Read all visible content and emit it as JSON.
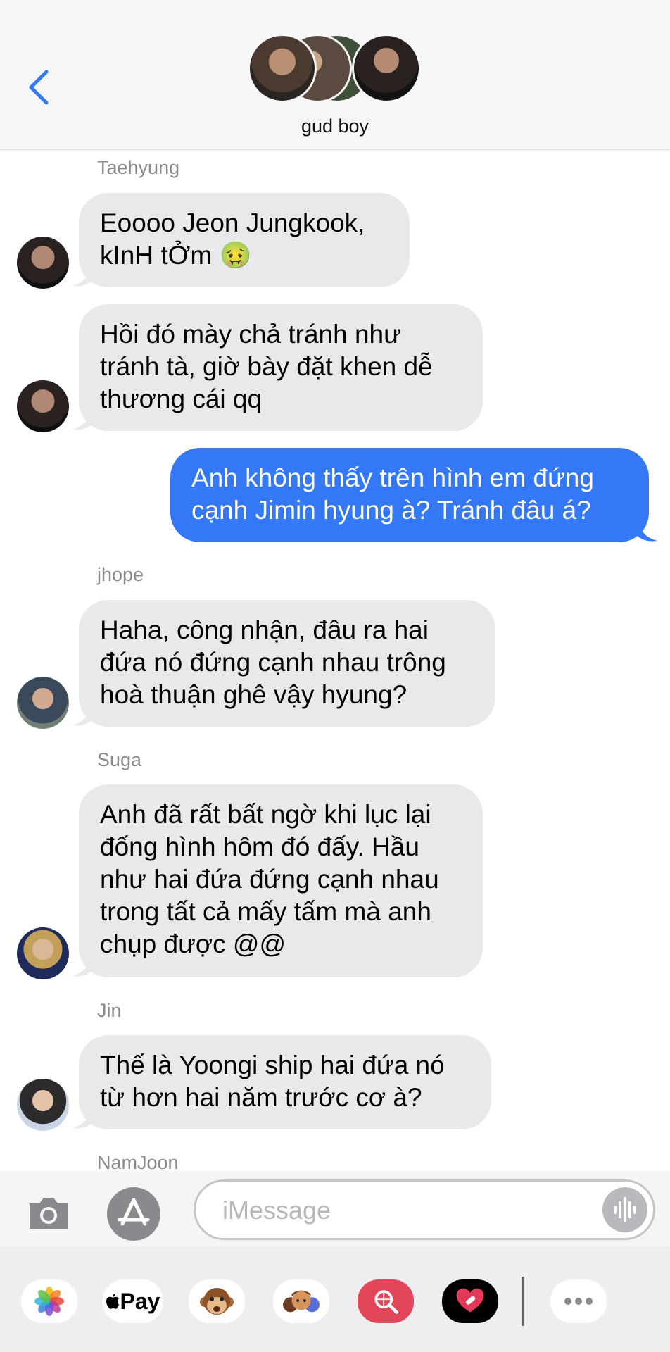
{
  "header": {
    "group_name": "gud boy"
  },
  "messages": [
    {
      "sender": "Taehyung",
      "lines": [
        "Eoooo Jeon Jungkook,",
        "kInH tỞm 🤢"
      ]
    },
    {
      "sender": "",
      "lines": [
        "Hồi đó mày chả tránh như",
        "tránh tà, giờ bày đặt khen dễ",
        "thương cái qq"
      ]
    },
    {
      "sender": "",
      "lines": [
        "Anh không thấy trên hình em đứng",
        "cạnh Jimin hyung à? Tránh đâu á?"
      ]
    },
    {
      "sender": "jhope",
      "lines": [
        "Haha, công nhận, đâu ra hai",
        "đứa nó đứng cạnh nhau trông",
        "hoà thuận ghê vậy hyung?"
      ]
    },
    {
      "sender": "Suga",
      "lines": [
        "Anh đã rất bất ngờ khi lục lại",
        "đống hình hôm đó đấy. Hầu",
        "như hai đứa đứng cạnh nhau",
        "trong tất cả mấy tấm mà anh",
        "chụp được @@"
      ]
    },
    {
      "sender": "Jin",
      "lines": [
        "Thế là Yoongi ship hai đứa nó",
        "từ hơn hai năm trước cơ à?"
      ]
    },
    {
      "sender": "NamJoon",
      "lines": []
    }
  ],
  "composer": {
    "placeholder": "iMessage"
  },
  "tray": {
    "apple_pay_label": "Pay"
  },
  "colors": {
    "outgoing_bubble": "#3478f6",
    "incoming_bubble": "#e9e9eb",
    "accent": "#3478f6"
  }
}
